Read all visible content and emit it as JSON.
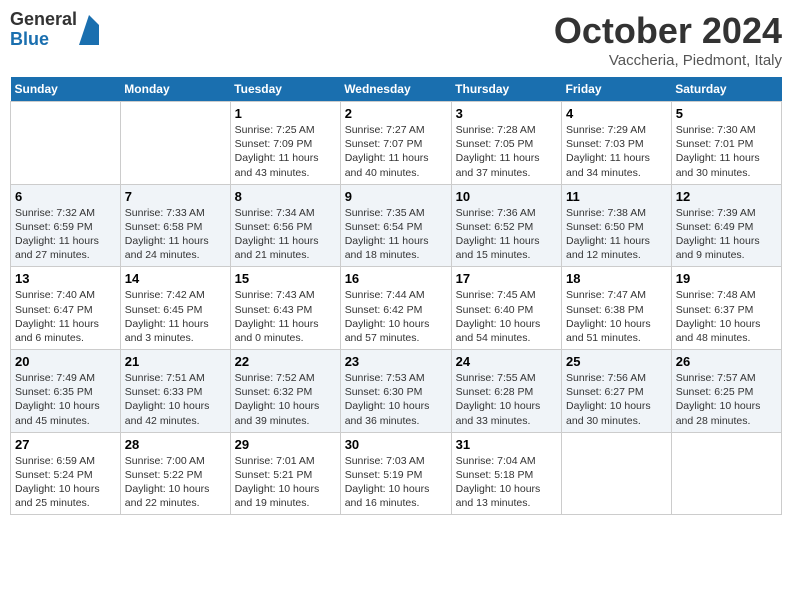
{
  "header": {
    "logo_general": "General",
    "logo_blue": "Blue",
    "month_title": "October 2024",
    "location": "Vaccheria, Piedmont, Italy"
  },
  "days_of_week": [
    "Sunday",
    "Monday",
    "Tuesday",
    "Wednesday",
    "Thursday",
    "Friday",
    "Saturday"
  ],
  "weeks": [
    [
      {
        "day": "",
        "sunrise": "",
        "sunset": "",
        "daylight": ""
      },
      {
        "day": "",
        "sunrise": "",
        "sunset": "",
        "daylight": ""
      },
      {
        "day": "1",
        "sunrise": "Sunrise: 7:25 AM",
        "sunset": "Sunset: 7:09 PM",
        "daylight": "Daylight: 11 hours and 43 minutes."
      },
      {
        "day": "2",
        "sunrise": "Sunrise: 7:27 AM",
        "sunset": "Sunset: 7:07 PM",
        "daylight": "Daylight: 11 hours and 40 minutes."
      },
      {
        "day": "3",
        "sunrise": "Sunrise: 7:28 AM",
        "sunset": "Sunset: 7:05 PM",
        "daylight": "Daylight: 11 hours and 37 minutes."
      },
      {
        "day": "4",
        "sunrise": "Sunrise: 7:29 AM",
        "sunset": "Sunset: 7:03 PM",
        "daylight": "Daylight: 11 hours and 34 minutes."
      },
      {
        "day": "5",
        "sunrise": "Sunrise: 7:30 AM",
        "sunset": "Sunset: 7:01 PM",
        "daylight": "Daylight: 11 hours and 30 minutes."
      }
    ],
    [
      {
        "day": "6",
        "sunrise": "Sunrise: 7:32 AM",
        "sunset": "Sunset: 6:59 PM",
        "daylight": "Daylight: 11 hours and 27 minutes."
      },
      {
        "day": "7",
        "sunrise": "Sunrise: 7:33 AM",
        "sunset": "Sunset: 6:58 PM",
        "daylight": "Daylight: 11 hours and 24 minutes."
      },
      {
        "day": "8",
        "sunrise": "Sunrise: 7:34 AM",
        "sunset": "Sunset: 6:56 PM",
        "daylight": "Daylight: 11 hours and 21 minutes."
      },
      {
        "day": "9",
        "sunrise": "Sunrise: 7:35 AM",
        "sunset": "Sunset: 6:54 PM",
        "daylight": "Daylight: 11 hours and 18 minutes."
      },
      {
        "day": "10",
        "sunrise": "Sunrise: 7:36 AM",
        "sunset": "Sunset: 6:52 PM",
        "daylight": "Daylight: 11 hours and 15 minutes."
      },
      {
        "day": "11",
        "sunrise": "Sunrise: 7:38 AM",
        "sunset": "Sunset: 6:50 PM",
        "daylight": "Daylight: 11 hours and 12 minutes."
      },
      {
        "day": "12",
        "sunrise": "Sunrise: 7:39 AM",
        "sunset": "Sunset: 6:49 PM",
        "daylight": "Daylight: 11 hours and 9 minutes."
      }
    ],
    [
      {
        "day": "13",
        "sunrise": "Sunrise: 7:40 AM",
        "sunset": "Sunset: 6:47 PM",
        "daylight": "Daylight: 11 hours and 6 minutes."
      },
      {
        "day": "14",
        "sunrise": "Sunrise: 7:42 AM",
        "sunset": "Sunset: 6:45 PM",
        "daylight": "Daylight: 11 hours and 3 minutes."
      },
      {
        "day": "15",
        "sunrise": "Sunrise: 7:43 AM",
        "sunset": "Sunset: 6:43 PM",
        "daylight": "Daylight: 11 hours and 0 minutes."
      },
      {
        "day": "16",
        "sunrise": "Sunrise: 7:44 AM",
        "sunset": "Sunset: 6:42 PM",
        "daylight": "Daylight: 10 hours and 57 minutes."
      },
      {
        "day": "17",
        "sunrise": "Sunrise: 7:45 AM",
        "sunset": "Sunset: 6:40 PM",
        "daylight": "Daylight: 10 hours and 54 minutes."
      },
      {
        "day": "18",
        "sunrise": "Sunrise: 7:47 AM",
        "sunset": "Sunset: 6:38 PM",
        "daylight": "Daylight: 10 hours and 51 minutes."
      },
      {
        "day": "19",
        "sunrise": "Sunrise: 7:48 AM",
        "sunset": "Sunset: 6:37 PM",
        "daylight": "Daylight: 10 hours and 48 minutes."
      }
    ],
    [
      {
        "day": "20",
        "sunrise": "Sunrise: 7:49 AM",
        "sunset": "Sunset: 6:35 PM",
        "daylight": "Daylight: 10 hours and 45 minutes."
      },
      {
        "day": "21",
        "sunrise": "Sunrise: 7:51 AM",
        "sunset": "Sunset: 6:33 PM",
        "daylight": "Daylight: 10 hours and 42 minutes."
      },
      {
        "day": "22",
        "sunrise": "Sunrise: 7:52 AM",
        "sunset": "Sunset: 6:32 PM",
        "daylight": "Daylight: 10 hours and 39 minutes."
      },
      {
        "day": "23",
        "sunrise": "Sunrise: 7:53 AM",
        "sunset": "Sunset: 6:30 PM",
        "daylight": "Daylight: 10 hours and 36 minutes."
      },
      {
        "day": "24",
        "sunrise": "Sunrise: 7:55 AM",
        "sunset": "Sunset: 6:28 PM",
        "daylight": "Daylight: 10 hours and 33 minutes."
      },
      {
        "day": "25",
        "sunrise": "Sunrise: 7:56 AM",
        "sunset": "Sunset: 6:27 PM",
        "daylight": "Daylight: 10 hours and 30 minutes."
      },
      {
        "day": "26",
        "sunrise": "Sunrise: 7:57 AM",
        "sunset": "Sunset: 6:25 PM",
        "daylight": "Daylight: 10 hours and 28 minutes."
      }
    ],
    [
      {
        "day": "27",
        "sunrise": "Sunrise: 6:59 AM",
        "sunset": "Sunset: 5:24 PM",
        "daylight": "Daylight: 10 hours and 25 minutes."
      },
      {
        "day": "28",
        "sunrise": "Sunrise: 7:00 AM",
        "sunset": "Sunset: 5:22 PM",
        "daylight": "Daylight: 10 hours and 22 minutes."
      },
      {
        "day": "29",
        "sunrise": "Sunrise: 7:01 AM",
        "sunset": "Sunset: 5:21 PM",
        "daylight": "Daylight: 10 hours and 19 minutes."
      },
      {
        "day": "30",
        "sunrise": "Sunrise: 7:03 AM",
        "sunset": "Sunset: 5:19 PM",
        "daylight": "Daylight: 10 hours and 16 minutes."
      },
      {
        "day": "31",
        "sunrise": "Sunrise: 7:04 AM",
        "sunset": "Sunset: 5:18 PM",
        "daylight": "Daylight: 10 hours and 13 minutes."
      },
      {
        "day": "",
        "sunrise": "",
        "sunset": "",
        "daylight": ""
      },
      {
        "day": "",
        "sunrise": "",
        "sunset": "",
        "daylight": ""
      }
    ]
  ]
}
